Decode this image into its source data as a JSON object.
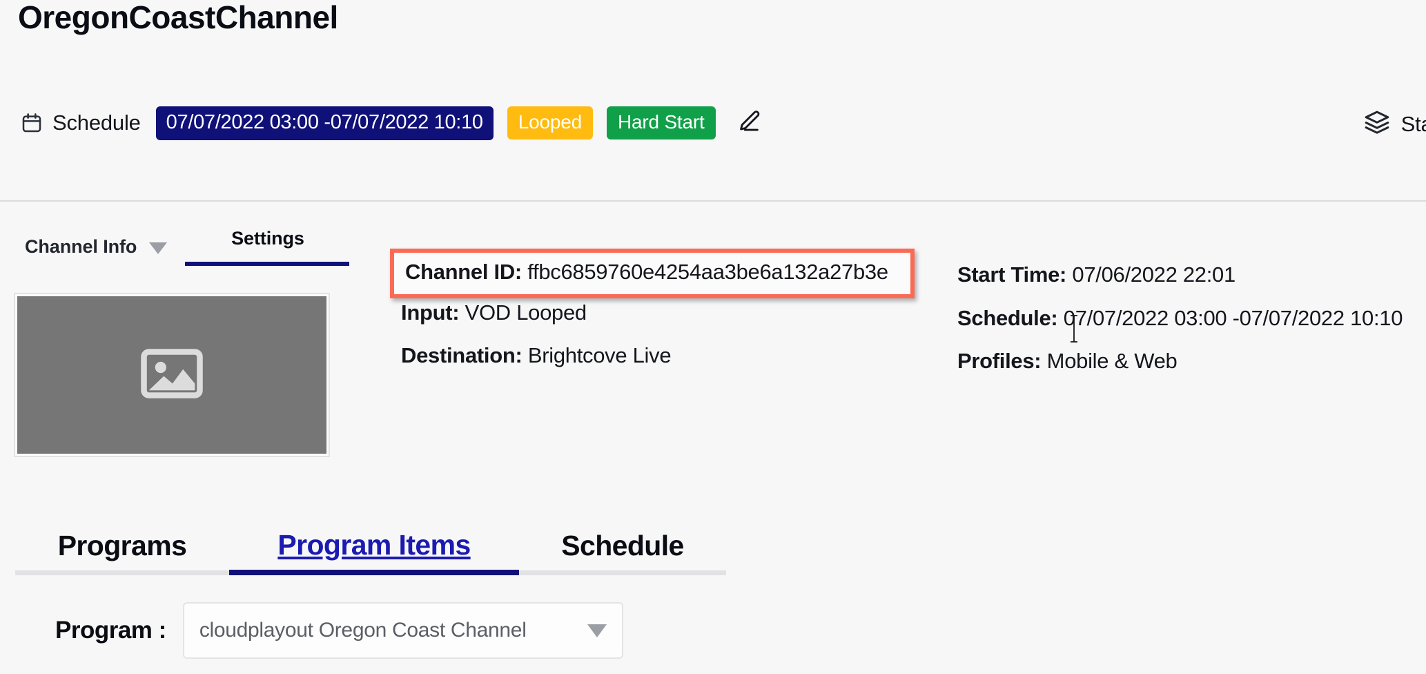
{
  "page_title": "OregonCoastChannel",
  "schedule_bar": {
    "calendar_icon": "calendar-icon",
    "label": "Schedule",
    "range": "07/07/2022 03:00 -07/07/2022 10:10",
    "badges": [
      {
        "label": "Looped",
        "color": "#ffbb10"
      },
      {
        "label": "Hard Start",
        "color": "#11a04a"
      }
    ],
    "edit_icon": "pencil-icon",
    "stat_icon": "layers-icon",
    "stat_label": "Stat"
  },
  "top_tabs": {
    "channel_info": {
      "label": "Channel Info",
      "icon": "chevron-down-icon"
    },
    "settings": {
      "label": "Settings",
      "active": true
    }
  },
  "thumbnail": {
    "placeholder_icon": "image-placeholder-icon",
    "background": "#767676"
  },
  "details_left": {
    "channel_id_label": "Channel ID:",
    "channel_id_value": "ffbc6859760e4254aa3be6a132a27b3e",
    "input_label": "Input:",
    "input_value": "VOD Looped",
    "destination_label": "Destination:",
    "destination_value": "Brightcove Live"
  },
  "details_right": {
    "start_time_label": "Start Time:",
    "start_time_value": "07/06/2022 22:01",
    "schedule_label": "Schedule:",
    "schedule_value": "07/07/2022 03:00 -07/07/2022 10:10",
    "profiles_label": "Profiles:",
    "profiles_value": "Mobile & Web"
  },
  "highlight": {
    "color": "#fb6a55",
    "target": "channel-id-row"
  },
  "bottom_tabs": [
    {
      "label": "Programs",
      "active": false
    },
    {
      "label": "Program Items",
      "active": true
    },
    {
      "label": "Schedule",
      "active": false
    }
  ],
  "program_selector": {
    "label": "Program :",
    "value": "cloudplayout Oregon Coast Channel",
    "caret_icon": "caret-down-icon"
  },
  "colors": {
    "accent_navy": "#101178",
    "badge_yellow": "#ffbb10",
    "badge_green": "#11a04a",
    "highlight_red": "#fb6a55",
    "page_bg": "#f7f7f8"
  }
}
